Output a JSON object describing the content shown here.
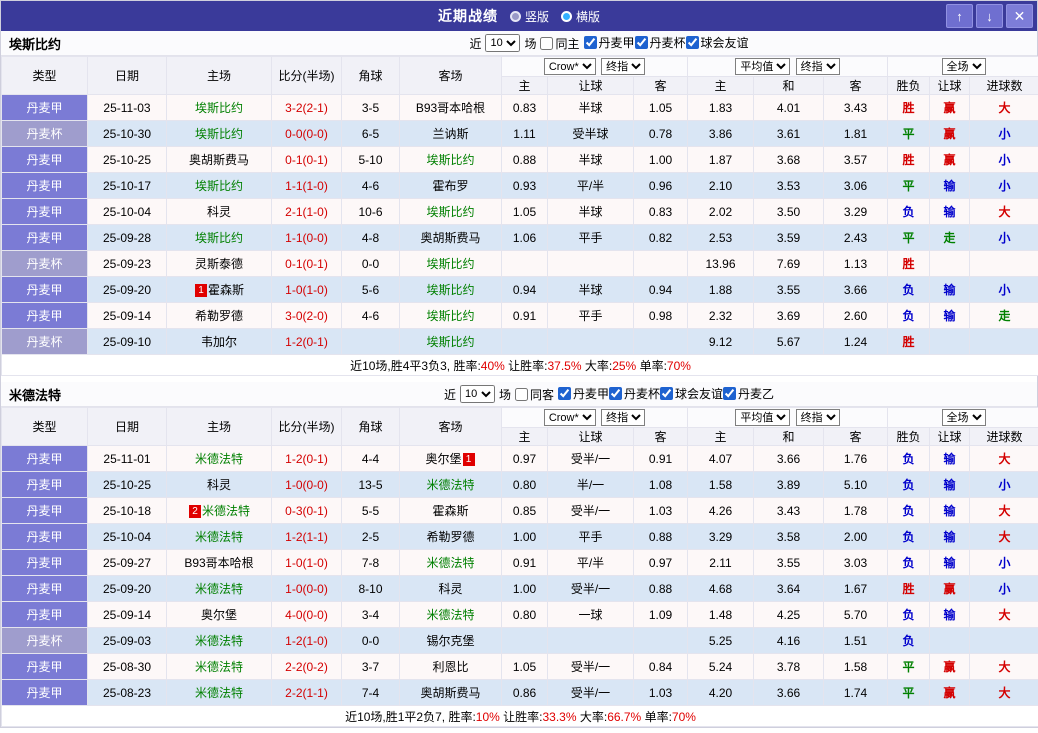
{
  "topbar": {
    "title": "近期战绩",
    "layout_vertical": "竖版",
    "layout_horizontal": "横版",
    "up": "↑",
    "down": "↓",
    "close": "✕"
  },
  "filter_labels": {
    "near": "近",
    "count": "10",
    "games": "场"
  },
  "selectors": {
    "book": "Crow*",
    "book_stage": "终指",
    "avg": "平均值",
    "avg_stage": "终指",
    "scope": "全场"
  },
  "header": {
    "type": "类型",
    "date": "日期",
    "home": "主场",
    "score": "比分(半场)",
    "corner": "角球",
    "away": "客场",
    "sub": [
      "主",
      "让球",
      "客",
      "主",
      "和",
      "客",
      "胜负",
      "让球",
      "进球数"
    ]
  },
  "result_colors": {
    "胜": "#d40000",
    "平": "#008000",
    "负": "#0000cc",
    "赢": "#d40000",
    "输": "#0000cc",
    "走": "#008000",
    "大": "#d40000",
    "小": "#0000cc"
  },
  "sections": [
    {
      "team": "埃斯比约",
      "same_label": "同主",
      "leagues": [
        "丹麦甲",
        "丹麦杯",
        "球会友谊"
      ],
      "rows": [
        {
          "type": "丹麦甲",
          "tc": "jia",
          "date": "25-11-03",
          "home": {
            "name": "埃斯比约",
            "subject": true
          },
          "score": "3-2(2-1)",
          "corner": "3-5",
          "away": {
            "name": "B93哥本哈根"
          },
          "o": [
            "0.83",
            "半球",
            "1.05"
          ],
          "a": [
            "1.83",
            "4.01",
            "3.43"
          ],
          "r": [
            "胜",
            "赢",
            "大"
          ]
        },
        {
          "type": "丹麦杯",
          "tc": "bei",
          "date": "25-10-30",
          "home": {
            "name": "埃斯比约",
            "subject": true
          },
          "score": "0-0(0-0)",
          "corner": "6-5",
          "away": {
            "name": "兰讷斯"
          },
          "o": [
            "1.11",
            "受半球",
            "0.78"
          ],
          "a": [
            "3.86",
            "3.61",
            "1.81"
          ],
          "r": [
            "平",
            "赢",
            "小"
          ]
        },
        {
          "type": "丹麦甲",
          "tc": "jia",
          "date": "25-10-25",
          "home": {
            "name": "奥胡斯费马"
          },
          "score": "0-1(0-1)",
          "corner": "5-10",
          "away": {
            "name": "埃斯比约",
            "subject": true
          },
          "o": [
            "0.88",
            "半球",
            "1.00"
          ],
          "a": [
            "1.87",
            "3.68",
            "3.57"
          ],
          "r": [
            "胜",
            "赢",
            "小"
          ]
        },
        {
          "type": "丹麦甲",
          "tc": "jia",
          "date": "25-10-17",
          "home": {
            "name": "埃斯比约",
            "subject": true
          },
          "score": "1-1(1-0)",
          "corner": "4-6",
          "away": {
            "name": "霍布罗"
          },
          "o": [
            "0.93",
            "平/半",
            "0.96"
          ],
          "a": [
            "2.10",
            "3.53",
            "3.06"
          ],
          "r": [
            "平",
            "输",
            "小"
          ]
        },
        {
          "type": "丹麦甲",
          "tc": "jia",
          "date": "25-10-04",
          "home": {
            "name": "科灵"
          },
          "score": "2-1(1-0)",
          "corner": "10-6",
          "away": {
            "name": "埃斯比约",
            "subject": true
          },
          "o": [
            "1.05",
            "半球",
            "0.83"
          ],
          "a": [
            "2.02",
            "3.50",
            "3.29"
          ],
          "r": [
            "负",
            "输",
            "大"
          ]
        },
        {
          "type": "丹麦甲",
          "tc": "jia",
          "date": "25-09-28",
          "home": {
            "name": "埃斯比约",
            "subject": true
          },
          "score": "1-1(0-0)",
          "corner": "4-8",
          "away": {
            "name": "奥胡斯费马"
          },
          "o": [
            "1.06",
            "平手",
            "0.82"
          ],
          "a": [
            "2.53",
            "3.59",
            "2.43"
          ],
          "r": [
            "平",
            "走",
            "小"
          ]
        },
        {
          "type": "丹麦杯",
          "tc": "bei",
          "date": "25-09-23",
          "home": {
            "name": "灵斯泰德"
          },
          "score": "0-1(0-1)",
          "corner": "0-0",
          "away": {
            "name": "埃斯比约",
            "subject": true
          },
          "o": [
            "",
            "",
            ""
          ],
          "a": [
            "13.96",
            "7.69",
            "1.13"
          ],
          "r": [
            "胜",
            "",
            ""
          ]
        },
        {
          "type": "丹麦甲",
          "tc": "jia",
          "date": "25-09-20",
          "home": {
            "name": "霍森斯",
            "badge": "1",
            "badge_pos": "before"
          },
          "score": "1-0(1-0)",
          "corner": "5-6",
          "away": {
            "name": "埃斯比约",
            "subject": true
          },
          "o": [
            "0.94",
            "半球",
            "0.94"
          ],
          "a": [
            "1.88",
            "3.55",
            "3.66"
          ],
          "r": [
            "负",
            "输",
            "小"
          ]
        },
        {
          "type": "丹麦甲",
          "tc": "jia",
          "date": "25-09-14",
          "home": {
            "name": "希勒罗德"
          },
          "score": "3-0(2-0)",
          "corner": "4-6",
          "away": {
            "name": "埃斯比约",
            "subject": true
          },
          "o": [
            "0.91",
            "平手",
            "0.98"
          ],
          "a": [
            "2.32",
            "3.69",
            "2.60"
          ],
          "r": [
            "负",
            "输",
            "走"
          ]
        },
        {
          "type": "丹麦杯",
          "tc": "bei",
          "date": "25-09-10",
          "home": {
            "name": "韦加尔"
          },
          "score": "1-2(0-1)",
          "corner": "",
          "away": {
            "name": "埃斯比约",
            "subject": true
          },
          "o": [
            "",
            "",
            ""
          ],
          "a": [
            "9.12",
            "5.67",
            "1.24"
          ],
          "r": [
            "胜",
            "",
            ""
          ]
        }
      ],
      "summary": [
        {
          "text": "近10场,胜4平3负3, ",
          "red": false
        },
        {
          "text": "胜率:",
          "red": false
        },
        {
          "text": "40%",
          "red": true
        },
        {
          "text": " 让胜率:",
          "red": false
        },
        {
          "text": "37.5%",
          "red": true
        },
        {
          "text": " 大率:",
          "red": false
        },
        {
          "text": "25%",
          "red": true
        },
        {
          "text": " 单率:",
          "red": false
        },
        {
          "text": "70%",
          "red": true
        }
      ]
    },
    {
      "team": "米德法特",
      "same_label": "同客",
      "leagues": [
        "丹麦甲",
        "丹麦杯",
        "球会友谊",
        "丹麦乙"
      ],
      "rows": [
        {
          "type": "丹麦甲",
          "tc": "jia",
          "date": "25-11-01",
          "home": {
            "name": "米德法特",
            "subject": true
          },
          "score": "1-2(0-1)",
          "corner": "4-4",
          "away": {
            "name": "奥尔堡",
            "badge": "1",
            "badge_pos": "after"
          },
          "o": [
            "0.97",
            "受半/一",
            "0.91"
          ],
          "a": [
            "4.07",
            "3.66",
            "1.76"
          ],
          "r": [
            "负",
            "输",
            "大"
          ]
        },
        {
          "type": "丹麦甲",
          "tc": "jia",
          "date": "25-10-25",
          "home": {
            "name": "科灵"
          },
          "score": "1-0(0-0)",
          "corner": "13-5",
          "away": {
            "name": "米德法特",
            "subject": true
          },
          "o": [
            "0.80",
            "半/一",
            "1.08"
          ],
          "a": [
            "1.58",
            "3.89",
            "5.10"
          ],
          "r": [
            "负",
            "输",
            "小"
          ]
        },
        {
          "type": "丹麦甲",
          "tc": "jia",
          "date": "25-10-18",
          "home": {
            "name": "米德法特",
            "subject": true,
            "badge": "2",
            "badge_pos": "before"
          },
          "score": "0-3(0-1)",
          "corner": "5-5",
          "away": {
            "name": "霍森斯"
          },
          "o": [
            "0.85",
            "受半/一",
            "1.03"
          ],
          "a": [
            "4.26",
            "3.43",
            "1.78"
          ],
          "r": [
            "负",
            "输",
            "大"
          ]
        },
        {
          "type": "丹麦甲",
          "tc": "jia",
          "date": "25-10-04",
          "home": {
            "name": "米德法特",
            "subject": true
          },
          "score": "1-2(1-1)",
          "corner": "2-5",
          "away": {
            "name": "希勒罗德"
          },
          "o": [
            "1.00",
            "平手",
            "0.88"
          ],
          "a": [
            "3.29",
            "3.58",
            "2.00"
          ],
          "r": [
            "负",
            "输",
            "大"
          ]
        },
        {
          "type": "丹麦甲",
          "tc": "jia",
          "date": "25-09-27",
          "home": {
            "name": "B93哥本哈根"
          },
          "score": "1-0(1-0)",
          "corner": "7-8",
          "away": {
            "name": "米德法特",
            "subject": true
          },
          "o": [
            "0.91",
            "平/半",
            "0.97"
          ],
          "a": [
            "2.11",
            "3.55",
            "3.03"
          ],
          "r": [
            "负",
            "输",
            "小"
          ]
        },
        {
          "type": "丹麦甲",
          "tc": "jia",
          "date": "25-09-20",
          "home": {
            "name": "米德法特",
            "subject": true
          },
          "score": "1-0(0-0)",
          "corner": "8-10",
          "away": {
            "name": "科灵"
          },
          "o": [
            "1.00",
            "受半/一",
            "0.88"
          ],
          "a": [
            "4.68",
            "3.64",
            "1.67"
          ],
          "r": [
            "胜",
            "赢",
            "小"
          ]
        },
        {
          "type": "丹麦甲",
          "tc": "jia",
          "date": "25-09-14",
          "home": {
            "name": "奥尔堡"
          },
          "score": "4-0(0-0)",
          "corner": "3-4",
          "away": {
            "name": "米德法特",
            "subject": true
          },
          "o": [
            "0.80",
            "一球",
            "1.09"
          ],
          "a": [
            "1.48",
            "4.25",
            "5.70"
          ],
          "r": [
            "负",
            "输",
            "大"
          ]
        },
        {
          "type": "丹麦杯",
          "tc": "bei",
          "date": "25-09-03",
          "home": {
            "name": "米德法特",
            "subject": true
          },
          "score": "1-2(1-0)",
          "corner": "0-0",
          "away": {
            "name": "锡尔克堡"
          },
          "o": [
            "",
            "",
            ""
          ],
          "a": [
            "5.25",
            "4.16",
            "1.51"
          ],
          "r": [
            "负",
            "",
            ""
          ]
        },
        {
          "type": "丹麦甲",
          "tc": "jia",
          "date": "25-08-30",
          "home": {
            "name": "米德法特",
            "subject": true
          },
          "score": "2-2(0-2)",
          "corner": "3-7",
          "away": {
            "name": "利恩比"
          },
          "o": [
            "1.05",
            "受半/一",
            "0.84"
          ],
          "a": [
            "5.24",
            "3.78",
            "1.58"
          ],
          "r": [
            "平",
            "赢",
            "大"
          ]
        },
        {
          "type": "丹麦甲",
          "tc": "jia",
          "date": "25-08-23",
          "home": {
            "name": "米德法特",
            "subject": true
          },
          "score": "2-2(1-1)",
          "corner": "7-4",
          "away": {
            "name": "奥胡斯费马"
          },
          "o": [
            "0.86",
            "受半/一",
            "1.03"
          ],
          "a": [
            "4.20",
            "3.66",
            "1.74"
          ],
          "r": [
            "平",
            "赢",
            "大"
          ]
        }
      ],
      "summary": [
        {
          "text": "近10场,胜1平2负7, ",
          "red": false
        },
        {
          "text": "胜率:",
          "red": false
        },
        {
          "text": "10%",
          "red": true
        },
        {
          "text": " 让胜率:",
          "red": false
        },
        {
          "text": "33.3%",
          "red": true
        },
        {
          "text": " 大率:",
          "red": false
        },
        {
          "text": "66.7%",
          "red": true
        },
        {
          "text": " 单率:",
          "red": false
        },
        {
          "text": "70%",
          "red": true
        }
      ]
    }
  ]
}
